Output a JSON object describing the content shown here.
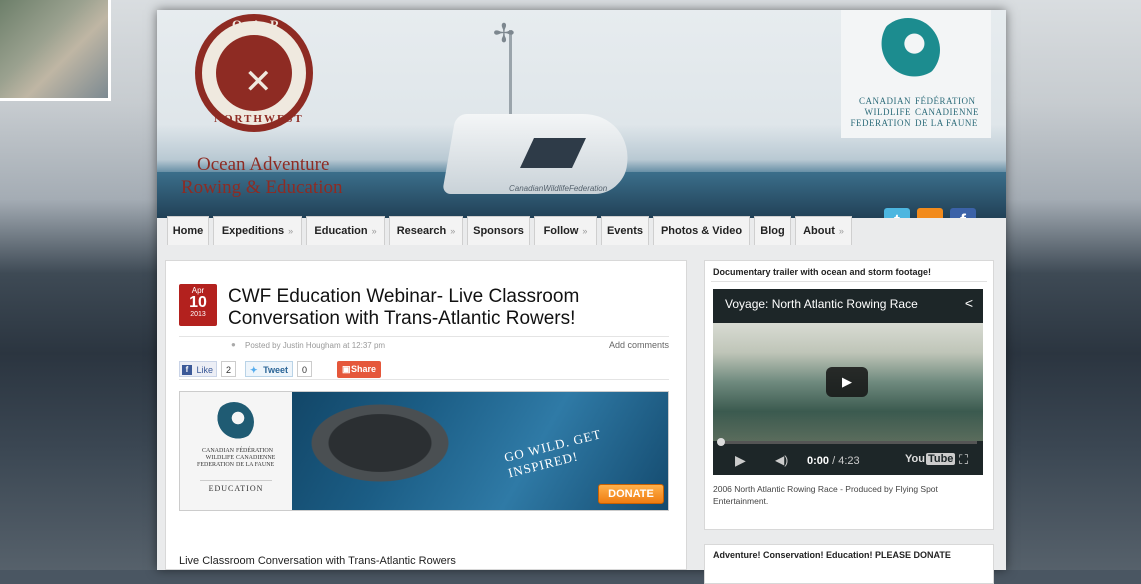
{
  "header": {
    "logo": {
      "ring_top": "O.A.R",
      "ring_bottom": "NORTHWEST",
      "tagline_line1": "Ocean Adventure",
      "tagline_line2": "Rowing & Education"
    },
    "boat_name": "CanadianWildlifeFederation",
    "partner_logo": {
      "en_line1": "CANADIAN",
      "en_line2": "WILDLIFE",
      "en_line3": "FEDERATION",
      "fr_line1": "FÉDÉRATION",
      "fr_line2": "CANADIENNE",
      "fr_line3": "DE LA FAUNE"
    }
  },
  "nav": {
    "items": [
      {
        "label": "Home"
      },
      {
        "label": "Expeditions"
      },
      {
        "label": "Education"
      },
      {
        "label": "Research"
      },
      {
        "label": "Sponsors"
      },
      {
        "label": "Follow"
      },
      {
        "label": "Events"
      },
      {
        "label": "Photos & Video"
      },
      {
        "label": "Blog"
      },
      {
        "label": "About"
      }
    ],
    "dropdown_glyph": "»",
    "social": [
      {
        "icon": "twitter-icon",
        "glyph": "t",
        "color": "#4cb6e0"
      },
      {
        "icon": "rss-icon",
        "glyph": "◔",
        "color": "#f28b1c"
      },
      {
        "icon": "facebook-icon",
        "glyph": "f",
        "color": "#3b62a8"
      }
    ]
  },
  "post": {
    "date": {
      "month": "Apr",
      "day": "10",
      "year": "2013"
    },
    "title": "CWF Education Webinar- Live Classroom Conversation with Trans-Atlantic Rowers!",
    "posted_by": "Posted by Justin Hougham at 12:37 pm",
    "add_comments": "Add comments",
    "share": {
      "fb_like_label": "Like",
      "fb_icon": "f",
      "fb_count": "2",
      "tweet_label": "Tweet",
      "tweet_count": "0",
      "share_label": "Share"
    },
    "banner": {
      "en_line1": "CANADIAN",
      "en_line2": "WILDLIFE",
      "en_line3": "FEDERATION",
      "fr_line1": "FÉDÉRATION",
      "fr_line2": "CANADIENNE",
      "fr_line3": "DE LA FAUNE",
      "education": "EDUCATION",
      "slogan": "GO WILD. GET INSPIRED!",
      "donate": "DONATE"
    },
    "body_first_line": "Live Classroom Conversation with Trans-Atlantic Rowers"
  },
  "sidebar": {
    "widget1": {
      "heading": "Documentary trailer with ocean and storm footage!",
      "video": {
        "title": "Voyage: North Atlantic Rowing Race",
        "current_time": "0:00",
        "duration": "/ 4:23",
        "progress": 0,
        "brand_you": "You",
        "brand_tube": "Tube"
      },
      "caption": "2006 North Atlantic Rowing Race - Produced by Flying Spot Entertainment."
    },
    "widget2": {
      "heading": "Adventure! Conservation! Education! PLEASE DONATE"
    }
  }
}
